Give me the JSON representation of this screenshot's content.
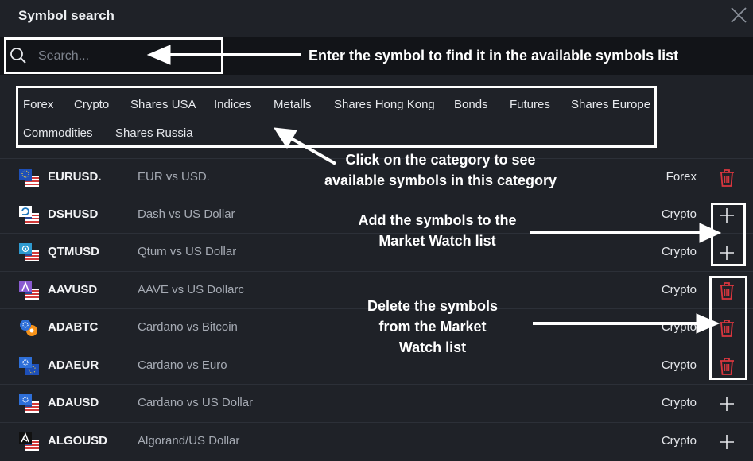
{
  "window": {
    "title": "Symbol search"
  },
  "search": {
    "placeholder": "Search..."
  },
  "categories": [
    "Forex",
    "Crypto",
    "Shares USA",
    "Indices",
    "Metalls",
    "Shares Hong Kong",
    "Bonds",
    "Futures",
    "Shares Europe",
    "Commodities",
    "Shares Russia"
  ],
  "symbols": [
    {
      "ticker": "EURUSD.",
      "name": "EUR vs USD.",
      "category": "Forex",
      "action": "trash-icon",
      "flag": "eu-us-flag-icon"
    },
    {
      "ticker": "DSHUSD",
      "name": "Dash vs US Dollar",
      "category": "Crypto",
      "action": "plus-icon",
      "flag": "dash-us-flag-icon"
    },
    {
      "ticker": "QTMUSD",
      "name": "Qtum vs US Dollar",
      "category": "Crypto",
      "action": "plus-icon",
      "flag": "qtum-us-flag-icon"
    },
    {
      "ticker": "AAVUSD",
      "name": "AAVE vs US Dollarc",
      "category": "Crypto",
      "action": "trash-icon",
      "flag": "aave-us-flag-icon"
    },
    {
      "ticker": "ADABTC",
      "name": "Cardano vs Bitcoin",
      "category": "Crypto",
      "action": "trash-icon",
      "flag": "ada-btc-flag-icon"
    },
    {
      "ticker": "ADAEUR",
      "name": "Cardano vs Euro",
      "category": "Crypto",
      "action": "trash-icon",
      "flag": "ada-eu-flag-icon"
    },
    {
      "ticker": "ADAUSD",
      "name": "Cardano vs US Dollar",
      "category": "Crypto",
      "action": "plus-icon",
      "flag": "ada-us-flag-icon"
    },
    {
      "ticker": "ALGOUSD",
      "name": "Algorand/US Dollar",
      "category": "Crypto",
      "action": "plus-icon",
      "flag": "algo-us-flag-icon"
    }
  ],
  "annotations": {
    "search": "Enter the symbol to find it in the available symbols list",
    "categories_line1": "Click on the category to see",
    "categories_line2": "available symbols in this category",
    "add_line1": "Add the symbols to the",
    "add_line2": "Market Watch list",
    "delete_line1": "Delete the symbols",
    "delete_line2": "from the Market",
    "delete_line3": "Watch list"
  },
  "colors": {
    "background": "#1f2228",
    "search_bg": "#121418",
    "delete_red": "#d9363e",
    "annotation": "#ffffff"
  }
}
